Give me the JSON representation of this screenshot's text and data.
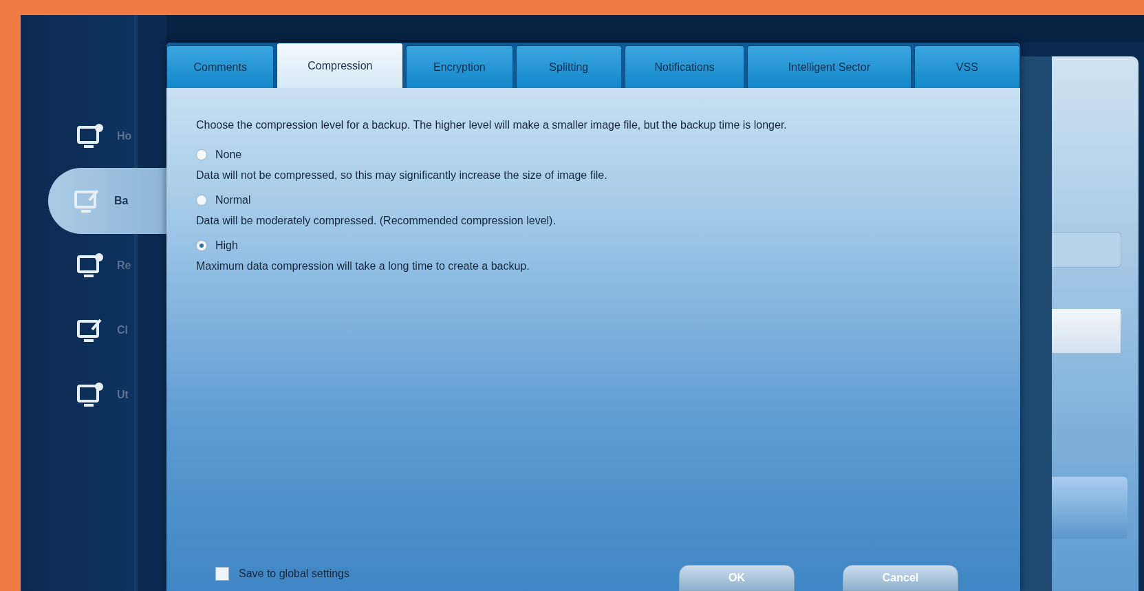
{
  "sidebar": {
    "items": [
      {
        "label": "Ho",
        "selected": false
      },
      {
        "label": "Ba",
        "selected": true
      },
      {
        "label": "Re",
        "selected": false
      },
      {
        "label": "Cl",
        "selected": false
      },
      {
        "label": "Ut",
        "selected": false
      }
    ]
  },
  "dialog": {
    "tabs": [
      {
        "label": "Comments",
        "selected": false
      },
      {
        "label": "Compression",
        "selected": true
      },
      {
        "label": "Encryption",
        "selected": false
      },
      {
        "label": "Splitting",
        "selected": false
      },
      {
        "label": "Notifications",
        "selected": false
      },
      {
        "label": "Intelligent Sector",
        "selected": false
      },
      {
        "label": "VSS",
        "selected": false
      }
    ],
    "description": "Choose the compression level for a backup. The higher level will make a smaller image file, but the backup time is longer.",
    "options": [
      {
        "label": "None",
        "selected": false,
        "description": "Data will not be compressed, so this may significantly increase the size of image file."
      },
      {
        "label": "Normal",
        "selected": false,
        "description": "Data will be moderately compressed. (Recommended compression level)."
      },
      {
        "label": "High",
        "selected": true,
        "description": "Maximum data compression will take a long time to create a backup."
      }
    ],
    "save_global": {
      "label": "Save to global settings",
      "checked": false
    },
    "buttons": [
      "OK",
      "Cancel"
    ]
  }
}
